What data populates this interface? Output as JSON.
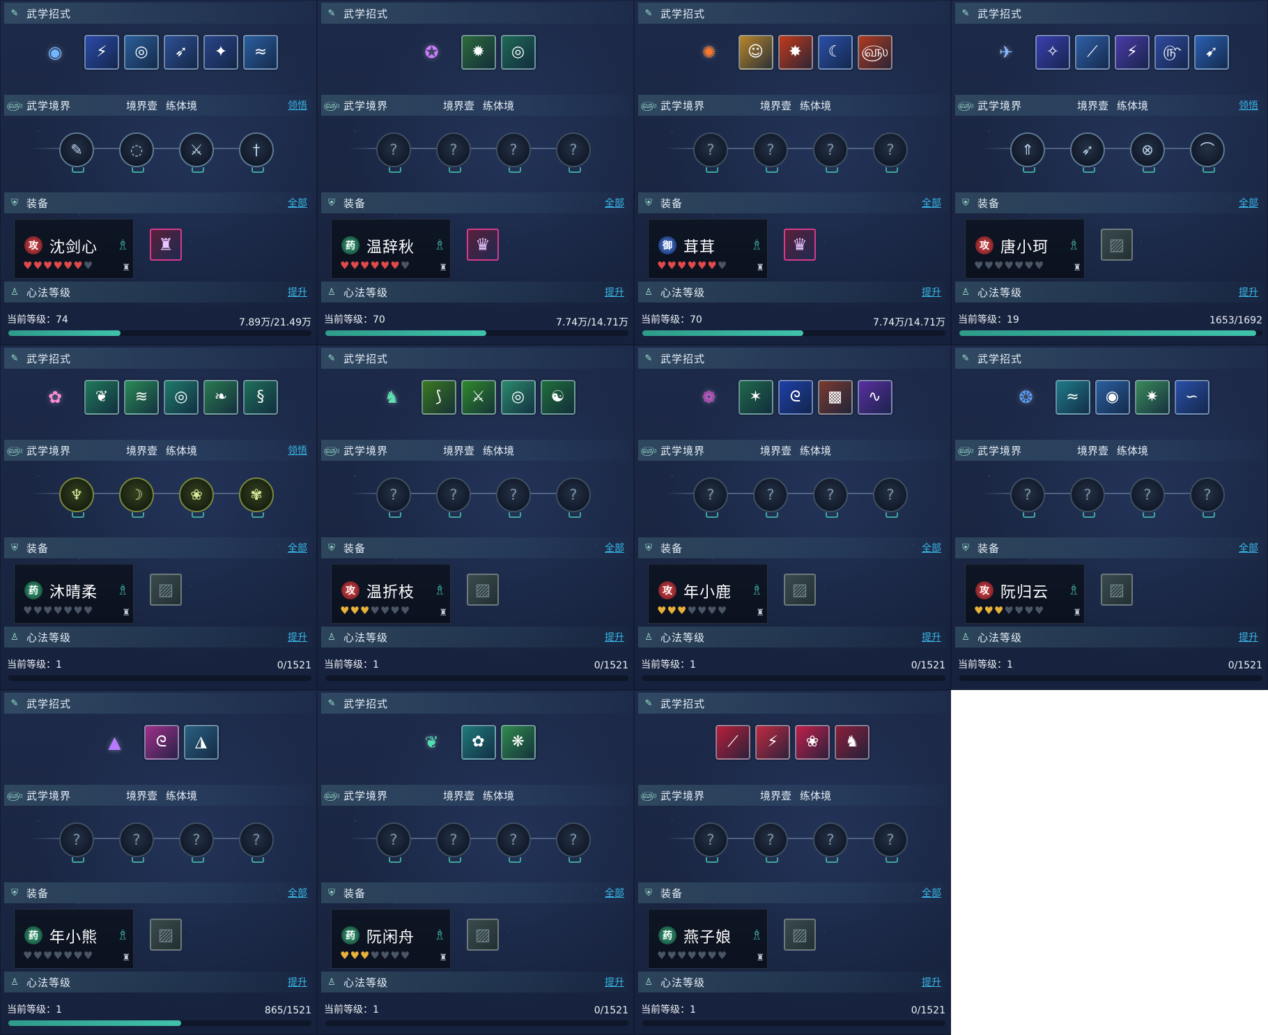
{
  "labels": {
    "skills_title": "武学招式",
    "realm_title": "武学境界",
    "realm_stage": "境界壹",
    "realm_name": "练体境",
    "lingwu_link": "领悟",
    "equip_title": "装备",
    "equip_all_link": "全部",
    "xinfa_title": "心法等级",
    "xinfa_upgrade_link": "提升"
  },
  "colors": {
    "accent_link": "#39b8e8",
    "exp_fill": "#40c2aa",
    "heart_red": "#e04a4a",
    "heart_gold": "#e8b23a"
  },
  "panels": [
    {
      "main_skill_icon": "blue-orb-icon",
      "main_skill_glyph": "◉",
      "main_skill_color": "#6fb6ff",
      "skill_tiles": [
        {
          "icon": "blue-slash-icon",
          "glyph": "⚡",
          "bg": "#2b4aa8"
        },
        {
          "icon": "blue-vortex-icon",
          "glyph": "◎",
          "bg": "#2a5e9a"
        },
        {
          "icon": "blue-wing-icon",
          "glyph": "➶",
          "bg": "#2d4f93"
        },
        {
          "icon": "blue-sword-icon",
          "glyph": "✦",
          "bg": "#2a4588"
        },
        {
          "icon": "blue-wave-icon",
          "glyph": "≈",
          "bg": "#2b5fa0"
        }
      ],
      "show_lingwu": true,
      "realm_nodes": [
        {
          "icon": "feather-icon",
          "glyph": "✎",
          "state": "unlocked"
        },
        {
          "icon": "swirl-icon",
          "glyph": "◌",
          "state": "unlocked"
        },
        {
          "icon": "blade-icon",
          "glyph": "⚔",
          "state": "unlocked"
        },
        {
          "icon": "sword-icon",
          "glyph": "†",
          "state": "unlocked"
        }
      ],
      "character": {
        "role": "atk",
        "role_char": "攻",
        "name": "沈剑心",
        "hearts": [
          "red",
          "red",
          "red",
          "red",
          "red",
          "red",
          "empty"
        ]
      },
      "equip": {
        "state": "filled",
        "icon": "armored-figure-icon",
        "glyph": "♜"
      },
      "level_label": "当前等级：74",
      "exp": "7.89万/21.49万",
      "progress": 0.37
    },
    {
      "main_skill_icon": "purple-figure-icon",
      "main_skill_glyph": "✪",
      "main_skill_color": "#d07aff",
      "skill_tiles": [
        {
          "icon": "green-burst-icon",
          "glyph": "✹",
          "bg": "#2c6b3a"
        },
        {
          "icon": "green-ring-icon",
          "glyph": "◎",
          "bg": "#1f6a55"
        }
      ],
      "show_lingwu": false,
      "realm_nodes": [
        {
          "icon": "locked-node-icon",
          "glyph": "?",
          "state": "locked"
        },
        {
          "icon": "locked-node-icon",
          "glyph": "?",
          "state": "locked"
        },
        {
          "icon": "locked-node-icon",
          "glyph": "?",
          "state": "locked"
        },
        {
          "icon": "locked-node-icon",
          "glyph": "?",
          "state": "locked"
        }
      ],
      "character": {
        "role": "heal",
        "role_char": "药",
        "name": "温辞秋",
        "hearts": [
          "red",
          "red",
          "red",
          "red",
          "red",
          "red",
          "empty"
        ]
      },
      "equip": {
        "state": "filled",
        "icon": "silver-armor-icon",
        "glyph": "♛"
      },
      "level_label": "当前等级：70",
      "exp": "7.74万/14.71万",
      "progress": 0.53
    },
    {
      "main_skill_icon": "flame-figure-icon",
      "main_skill_glyph": "✺",
      "main_skill_color": "#ff7a2a",
      "skill_tiles": [
        {
          "icon": "golden-buddha-icon",
          "glyph": "☺",
          "bg": "#b8862a"
        },
        {
          "icon": "fire-burst-icon",
          "glyph": "✸",
          "bg": "#c23a1a"
        },
        {
          "icon": "crescent-moon-icon",
          "glyph": "☾",
          "bg": "#2a4fa8"
        },
        {
          "icon": "fire-spiral-icon",
          "glyph": "௵",
          "bg": "#b03a1f"
        }
      ],
      "show_lingwu": false,
      "realm_nodes": [
        {
          "icon": "locked-node-icon",
          "glyph": "?",
          "state": "locked"
        },
        {
          "icon": "locked-node-icon",
          "glyph": "?",
          "state": "locked"
        },
        {
          "icon": "locked-node-icon",
          "glyph": "?",
          "state": "locked"
        },
        {
          "icon": "locked-node-icon",
          "glyph": "?",
          "state": "locked"
        }
      ],
      "character": {
        "role": "def",
        "role_char": "御",
        "name": "茸茸",
        "hearts": [
          "red",
          "red",
          "red",
          "red",
          "red",
          "red",
          "empty"
        ]
      },
      "equip": {
        "state": "filled",
        "icon": "silver-armor-icon",
        "glyph": "♛"
      },
      "level_label": "当前等级：70",
      "exp": "7.74万/14.71万",
      "progress": 0.53
    },
    {
      "main_skill_icon": "blue-bird-icon",
      "main_skill_glyph": "✈",
      "main_skill_color": "#8ab8ff",
      "skill_tiles": [
        {
          "icon": "blue-dancer-icon",
          "glyph": "✧",
          "bg": "#3a3fb0"
        },
        {
          "icon": "blue-feather-icon",
          "glyph": "⟋",
          "bg": "#2f5fa8"
        },
        {
          "icon": "purple-slash-icon",
          "glyph": "⚡",
          "bg": "#4a3aa8"
        },
        {
          "icon": "blue-spin-icon",
          "glyph": "௹",
          "bg": "#2f4aa0"
        },
        {
          "icon": "blue-leap-icon",
          "glyph": "➹",
          "bg": "#2a5fb0"
        }
      ],
      "show_lingwu": true,
      "realm_nodes": [
        {
          "icon": "arrow-up-icon",
          "glyph": "⇑",
          "state": "unlocked"
        },
        {
          "icon": "arrows-icon",
          "glyph": "➶",
          "state": "unlocked"
        },
        {
          "icon": "crossed-circle-icon",
          "glyph": "⊗",
          "state": "unlocked"
        },
        {
          "icon": "bow-icon",
          "glyph": "⌒",
          "state": "unlocked"
        }
      ],
      "character": {
        "role": "atk",
        "role_char": "攻",
        "name": "唐小珂",
        "hearts": [
          "empty",
          "empty",
          "empty",
          "empty",
          "empty",
          "empty",
          "empty"
        ]
      },
      "equip": {
        "state": "empty",
        "icon": "empty-slot-icon",
        "glyph": "▨"
      },
      "level_label": "当前等级：19",
      "exp": "1653/1692",
      "progress": 0.98
    },
    {
      "main_skill_icon": "pink-dancer-icon",
      "main_skill_glyph": "✿",
      "main_skill_color": "#ff88d8",
      "skill_tiles": [
        {
          "icon": "green-dragon-icon",
          "glyph": "❦",
          "bg": "#1f7a5a"
        },
        {
          "icon": "green-wind-icon",
          "glyph": "≋",
          "bg": "#2a8a55"
        },
        {
          "icon": "green-swirl-icon",
          "glyph": "◎",
          "bg": "#1f7a6a"
        },
        {
          "icon": "green-leaf-icon",
          "glyph": "❧",
          "bg": "#2a7a50"
        },
        {
          "icon": "green-serpent-icon",
          "glyph": "§",
          "bg": "#1f6f5a"
        }
      ],
      "show_lingwu": true,
      "realm_nodes": [
        {
          "icon": "lotus-bud-icon",
          "glyph": "♆",
          "state": "green"
        },
        {
          "icon": "crescent-flower-icon",
          "glyph": "☽",
          "state": "green"
        },
        {
          "icon": "lotus-icon",
          "glyph": "❀",
          "state": "green"
        },
        {
          "icon": "lotus-bloom-icon",
          "glyph": "✾",
          "state": "green"
        }
      ],
      "character": {
        "role": "heal",
        "role_char": "药",
        "name": "沐晴柔",
        "hearts": [
          "empty",
          "empty",
          "empty",
          "empty",
          "empty",
          "empty",
          "empty"
        ]
      },
      "equip": {
        "state": "empty",
        "icon": "empty-slot-icon",
        "glyph": "▨"
      },
      "level_label": "当前等级：1",
      "exp": "0/1521",
      "progress": 0.0
    },
    {
      "main_skill_icon": "green-warrior-icon",
      "main_skill_glyph": "♞",
      "main_skill_color": "#5fe0b0",
      "skill_tiles": [
        {
          "icon": "green-claw-icon",
          "glyph": "⟆",
          "bg": "#3a7a1f"
        },
        {
          "icon": "green-blade-icon",
          "glyph": "⚔",
          "bg": "#2f8a2a"
        },
        {
          "icon": "green-ring-icon",
          "glyph": "◎",
          "bg": "#2a8a6a"
        },
        {
          "icon": "taiji-icon",
          "glyph": "☯",
          "bg": "#1f6f3a"
        }
      ],
      "show_lingwu": false,
      "realm_nodes": [
        {
          "icon": "locked-node-icon",
          "glyph": "?",
          "state": "locked"
        },
        {
          "icon": "locked-node-icon",
          "glyph": "?",
          "state": "locked"
        },
        {
          "icon": "locked-node-icon",
          "glyph": "?",
          "state": "locked"
        },
        {
          "icon": "locked-node-icon",
          "glyph": "?",
          "state": "locked"
        }
      ],
      "character": {
        "role": "atk",
        "role_char": "攻",
        "name": "温折枝",
        "hearts": [
          "gold",
          "gold",
          "gold",
          "empty",
          "empty",
          "empty",
          "empty"
        ]
      },
      "equip": {
        "state": "empty",
        "icon": "empty-slot-icon",
        "glyph": "▨"
      },
      "level_label": "当前等级：1",
      "exp": "0/1521",
      "progress": 0.0
    },
    {
      "main_skill_icon": "purple-rose-icon",
      "main_skill_glyph": "❁",
      "main_skill_color": "#e05ad8",
      "skill_tiles": [
        {
          "icon": "green-star-icon",
          "glyph": "✶",
          "bg": "#1f6a4a"
        },
        {
          "icon": "blue-dragon-icon",
          "glyph": "ᘓ",
          "bg": "#1f3fa8"
        },
        {
          "icon": "red-rock-icon",
          "glyph": "▩",
          "bg": "#7a3a2f"
        },
        {
          "icon": "purple-wave-icon",
          "glyph": "∿",
          "bg": "#5a2fa0"
        }
      ],
      "show_lingwu": false,
      "realm_nodes": [
        {
          "icon": "locked-node-icon",
          "glyph": "?",
          "state": "locked"
        },
        {
          "icon": "locked-node-icon",
          "glyph": "?",
          "state": "locked"
        },
        {
          "icon": "locked-node-icon",
          "glyph": "?",
          "state": "locked"
        },
        {
          "icon": "locked-node-icon",
          "glyph": "?",
          "state": "locked"
        }
      ],
      "character": {
        "role": "atk",
        "role_char": "攻",
        "name": "年小鹿",
        "hearts": [
          "gold",
          "gold",
          "gold",
          "empty",
          "empty",
          "empty",
          "empty"
        ]
      },
      "equip": {
        "state": "empty",
        "icon": "empty-slot-icon",
        "glyph": "▨"
      },
      "level_label": "当前等级：1",
      "exp": "0/1521",
      "progress": 0.0
    },
    {
      "main_skill_icon": "blue-wisp-icon",
      "main_skill_glyph": "❂",
      "main_skill_color": "#5aa0ff",
      "skill_tiles": [
        {
          "icon": "teal-stream-icon",
          "glyph": "≈",
          "bg": "#1f7a8a"
        },
        {
          "icon": "blue-whirl-icon",
          "glyph": "◉",
          "bg": "#2a5fa0"
        },
        {
          "icon": "green-spark-icon",
          "glyph": "✷",
          "bg": "#3a8a5a"
        },
        {
          "icon": "blue-tide-icon",
          "glyph": "∽",
          "bg": "#2a4fa8"
        }
      ],
      "show_lingwu": false,
      "realm_nodes": [
        {
          "icon": "locked-node-icon",
          "glyph": "?",
          "state": "locked"
        },
        {
          "icon": "locked-node-icon",
          "glyph": "?",
          "state": "locked"
        },
        {
          "icon": "locked-node-icon",
          "glyph": "?",
          "state": "locked"
        },
        {
          "icon": "locked-node-icon",
          "glyph": "?",
          "state": "locked"
        }
      ],
      "character": {
        "role": "atk",
        "role_char": "攻",
        "name": "阮归云",
        "hearts": [
          "gold",
          "gold",
          "gold",
          "empty",
          "empty",
          "empty",
          "empty"
        ]
      },
      "equip": {
        "state": "empty",
        "icon": "empty-slot-icon",
        "glyph": "▨"
      },
      "level_label": "当前等级：1",
      "exp": "0/1521",
      "progress": 0.0
    },
    {
      "main_skill_icon": "purple-cone-icon",
      "main_skill_glyph": "▲",
      "main_skill_color": "#b77aff",
      "skill_tiles": [
        {
          "icon": "pink-serpent-icon",
          "glyph": "ᘓ",
          "bg": "#a02f8a"
        },
        {
          "icon": "fish-bite-icon",
          "glyph": "◮",
          "bg": "#2a5f80"
        }
      ],
      "show_lingwu": false,
      "realm_nodes": [
        {
          "icon": "locked-node-icon",
          "glyph": "?",
          "state": "locked"
        },
        {
          "icon": "locked-node-icon",
          "glyph": "?",
          "state": "locked"
        },
        {
          "icon": "locked-node-icon",
          "glyph": "?",
          "state": "locked"
        },
        {
          "icon": "locked-node-icon",
          "glyph": "?",
          "state": "locked"
        }
      ],
      "character": {
        "role": "heal",
        "role_char": "药",
        "name": "年小熊",
        "hearts": [
          "empty",
          "empty",
          "empty",
          "empty",
          "empty",
          "empty",
          "empty"
        ]
      },
      "equip": {
        "state": "empty",
        "icon": "empty-slot-icon",
        "glyph": "▨"
      },
      "level_label": "当前等级：1",
      "exp": "865/1521",
      "progress": 0.57
    },
    {
      "main_skill_icon": "green-leaf-icon",
      "main_skill_glyph": "❦",
      "main_skill_color": "#4fe0b0",
      "skill_tiles": [
        {
          "icon": "teal-flower-icon",
          "glyph": "✿",
          "bg": "#1f7a7a"
        },
        {
          "icon": "green-daisy-icon",
          "glyph": "❋",
          "bg": "#2f8a4a"
        }
      ],
      "show_lingwu": false,
      "realm_nodes": [
        {
          "icon": "locked-node-icon",
          "glyph": "?",
          "state": "locked"
        },
        {
          "icon": "locked-node-icon",
          "glyph": "?",
          "state": "locked"
        },
        {
          "icon": "locked-node-icon",
          "glyph": "?",
          "state": "locked"
        },
        {
          "icon": "locked-node-icon",
          "glyph": "?",
          "state": "locked"
        }
      ],
      "character": {
        "role": "heal",
        "role_char": "药",
        "name": "阮闲舟",
        "hearts": [
          "gold",
          "gold",
          "gold",
          "empty",
          "empty",
          "empty",
          "empty"
        ]
      },
      "equip": {
        "state": "empty",
        "icon": "empty-slot-icon",
        "glyph": "▨"
      },
      "level_label": "当前等级：1",
      "exp": "0/1521",
      "progress": 0.0
    },
    {
      "main_skill_icon": "",
      "main_skill_glyph": "",
      "main_skill_color": "",
      "skill_tiles": [
        {
          "icon": "red-slash-icon",
          "glyph": "⟋",
          "bg": "#b81f3a"
        },
        {
          "icon": "red-strike-icon",
          "glyph": "⚡",
          "bg": "#c02a40"
        },
        {
          "icon": "red-rose-icon",
          "glyph": "❀",
          "bg": "#c01f4a"
        },
        {
          "icon": "red-warrior-icon",
          "glyph": "♞",
          "bg": "#8a1f3a"
        }
      ],
      "show_lingwu": false,
      "realm_nodes": [
        {
          "icon": "locked-node-icon",
          "glyph": "?",
          "state": "locked"
        },
        {
          "icon": "locked-node-icon",
          "glyph": "?",
          "state": "locked"
        },
        {
          "icon": "locked-node-icon",
          "glyph": "?",
          "state": "locked"
        },
        {
          "icon": "locked-node-icon",
          "glyph": "?",
          "state": "locked"
        }
      ],
      "character": {
        "role": "heal",
        "role_char": "药",
        "name": "燕子娘",
        "hearts": [
          "empty",
          "empty",
          "empty",
          "empty",
          "empty",
          "empty",
          "empty"
        ]
      },
      "equip": {
        "state": "empty",
        "icon": "empty-slot-icon",
        "glyph": "▨"
      },
      "level_label": "当前等级：1",
      "exp": "0/1521",
      "progress": 0.0
    }
  ]
}
